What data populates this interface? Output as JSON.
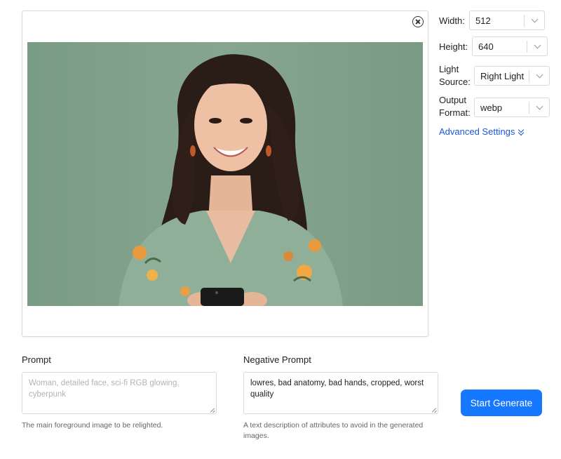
{
  "preview": {
    "close_label": "close",
    "image_alt": "Smiling woman with long dark wavy hair in a green floral dress holding a phone"
  },
  "settings": {
    "width": {
      "label": "Width:",
      "value": "512"
    },
    "height": {
      "label": "Height:",
      "value": "640"
    },
    "light_source": {
      "label_line1": "Light",
      "label_line2": "Source:",
      "value": "Right Light"
    },
    "output_format": {
      "label_line1": "Output",
      "label_line2": "Format:",
      "value": "webp"
    },
    "advanced_link": "Advanced Settings"
  },
  "prompt": {
    "label": "Prompt",
    "placeholder": "Woman, detailed face, sci-fi RGB glowing, cyberpunk",
    "value": "",
    "help": "The main foreground image to be relighted."
  },
  "negative_prompt": {
    "label": "Negative Prompt",
    "value": "lowres, bad anatomy, bad hands, cropped, worst quality",
    "help": "A text description of attributes to avoid in the generated images."
  },
  "actions": {
    "start_label": "Start Generate"
  },
  "colors": {
    "accent": "#1677ff",
    "link": "#1a56db",
    "photo_background": "#83a28c"
  },
  "icons": [
    "close-circle-icon",
    "chevron-down-icon",
    "double-chevron-down-icon",
    "resize-grip-icon"
  ]
}
